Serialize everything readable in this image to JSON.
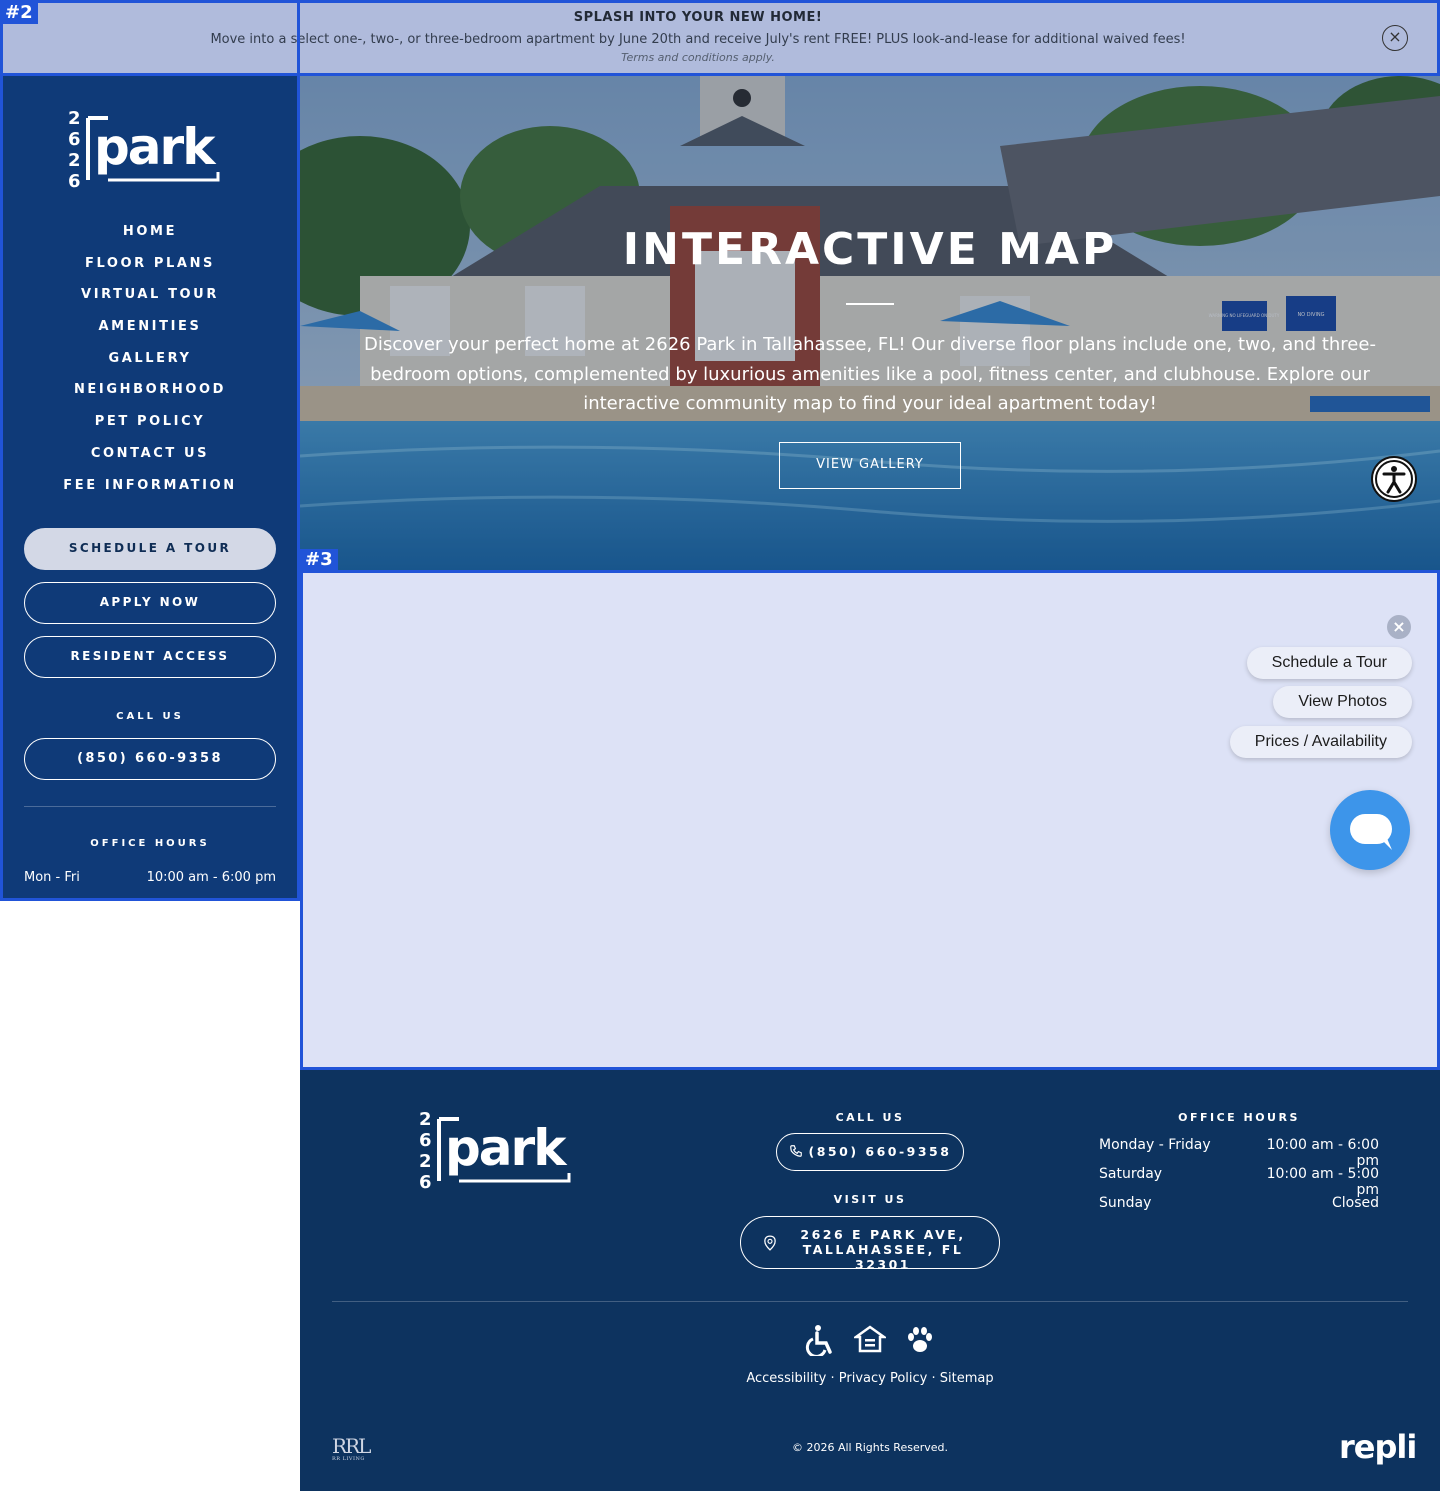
{
  "banner": {
    "title": "SPLASH INTO YOUR NEW HOME!",
    "text": "Move into a select one-, two-, or three-bedroom apartment by June 20th and receive July's rent FREE! PLUS look-and-lease for additional waived fees!",
    "terms": "Terms and conditions apply.",
    "close_icon": "×"
  },
  "logo": {
    "digits": [
      "2",
      "6",
      "2",
      "6"
    ],
    "word": "park"
  },
  "sidebar": {
    "nav": [
      "HOME",
      "FLOOR PLANS",
      "VIRTUAL TOUR",
      "AMENITIES",
      "GALLERY",
      "NEIGHBORHOOD",
      "PET POLICY",
      "CONTACT US",
      "FEE INFORMATION"
    ],
    "schedule_tour": "SCHEDULE A TOUR",
    "apply_now": "APPLY NOW",
    "resident_access": "RESIDENT ACCESS",
    "call_label": "CALL US",
    "phone": "(850) 660-9358",
    "hours_label": "OFFICE HOURS",
    "hours_day": "Mon - Fri",
    "hours_time": "10:00 am - 6:00 pm"
  },
  "hero": {
    "title": "INTERACTIVE MAP",
    "description": "Discover your perfect home at 2626 Park in Tallahassee, FL! Our diverse floor plans include one, two, and three-bedroom options, complemented by luxurious amenities like a pool, fitness center, and clubhouse. Explore our interactive community map to find your ideal apartment today!",
    "button": "VIEW GALLERY",
    "sign_1": "WARNING NO LIFEGUARD ON DUTY",
    "sign_2": "NO DIVING"
  },
  "floating": {
    "close_icon": "×",
    "schedule_tour": "Schedule a Tour",
    "view_photos": "View Photos",
    "prices": "Prices / Availability"
  },
  "footer": {
    "call_label": "CALL US",
    "phone": "(850) 660-9358",
    "visit_label": "VISIT US",
    "address_line1": "2626 E PARK AVE,",
    "address_line2": "TALLAHASSEE, FL 32301",
    "hours_label": "OFFICE HOURS",
    "hours": [
      {
        "day": "Monday - Friday",
        "time": "10:00 am - 6:00 pm"
      },
      {
        "day": "Saturday",
        "time": "10:00 am - 5:00 pm"
      },
      {
        "day": "Sunday",
        "time": "Closed"
      }
    ],
    "links": [
      "Accessibility",
      "Privacy Policy",
      "Sitemap"
    ],
    "separator": "·",
    "copyright": "© 2026 All Rights Reserved.",
    "rrl": "RRL",
    "rrl_sub": "RR LIVING",
    "repli": "repli"
  },
  "annotations": {
    "tag_2": "#2",
    "tag_3": "#3"
  },
  "colors": {
    "sidebar": "#0f3a78",
    "footer": "#0d335f",
    "banner": "#b0bbdc",
    "map_area": "#dde2f6",
    "chat": "#3d95ea",
    "annotation": "#2154d8"
  }
}
